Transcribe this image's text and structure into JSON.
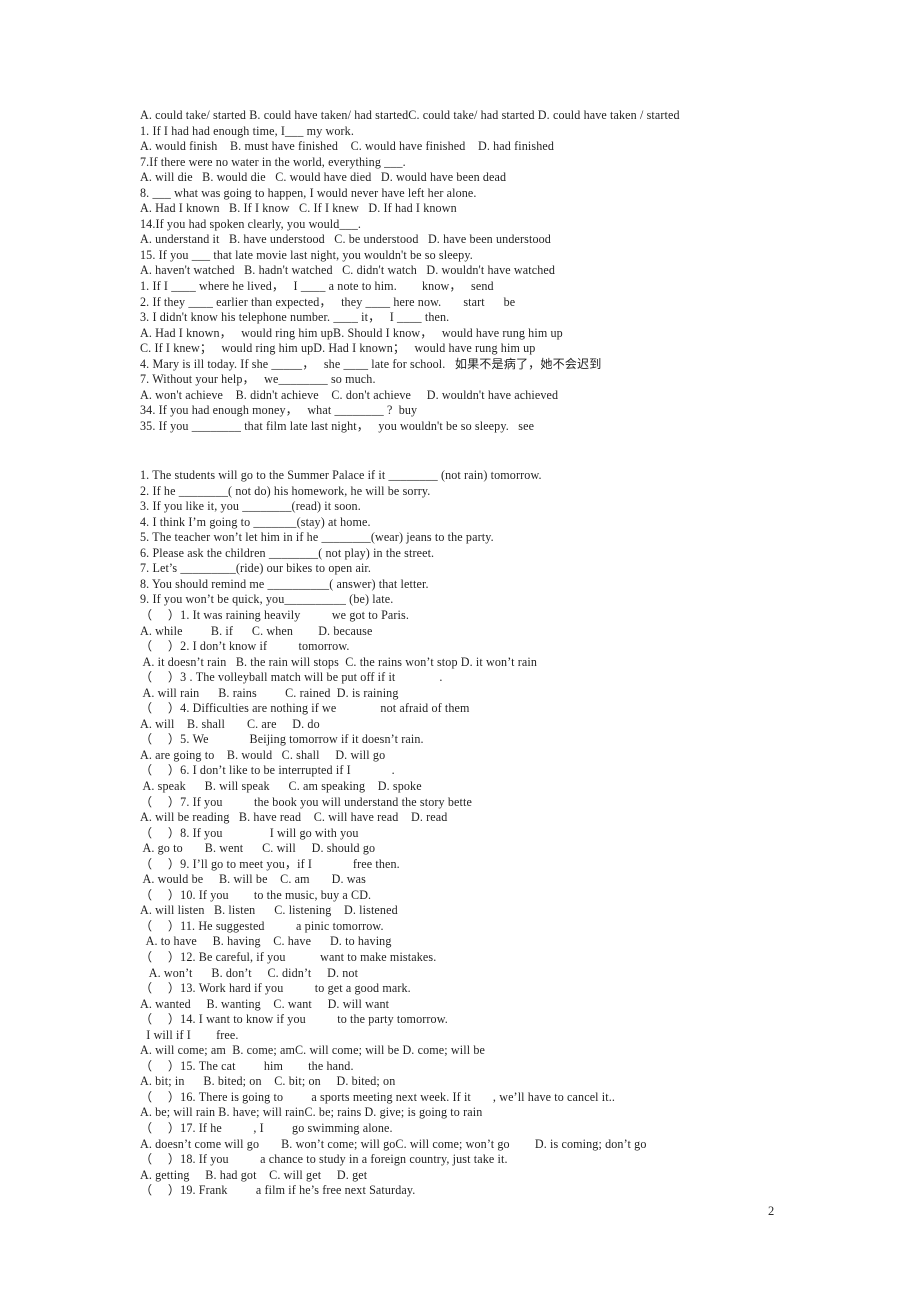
{
  "document": {
    "page_number": "2",
    "sections": [
      {
        "name": "multiple-choice-conditionals",
        "lines": [
          "A. could take/ started B. could have taken/ had startedC. could take/ had started D. could have taken / started",
          "1. If I had had enough time, I___ my work.",
          "A. would finish    B. must have finished    C. would have finished    D. had finished",
          "7.If there were no water in the world, everything ___.",
          "A. will die   B. would die   C. would have died   D. would have been dead",
          "8. ___ what was going to happen, I would never have left her alone.",
          "A. Had I known   B. If I know   C. If I knew   D. If had I known",
          "14.If you had spoken clearly, you would___.",
          "A. understand it   B. have understood   C. be understood   D. have been understood",
          "15. If you ___ that late movie last night, you wouldn't be so sleepy.",
          "A. haven't watched   B. hadn't watched   C. didn't watch   D. wouldn't have watched",
          "1. If I ____ where he lived，   I ____ a note to him.        know，   send",
          "2. If they ____ earlier than expected，   they ____ here now.       start      be",
          "3. I didn't know his telephone number. ____ it，   I ____ then.",
          "A. Had I known，   would ring him upB. Should I know，   would have rung him up",
          "C. If I knew；   would ring him upD. Had I known；   would have rung him up",
          "4. Mary is ill today. If she _____，   she ____ late for school.   如果不是病了，她不会迟到",
          "7. Without your help，   we________ so much.",
          "A. won't achieve    B. didn't achieve    C. don't achieve     D. wouldn't have achieved",
          "34. If you had enough money，   what ________ ?  buy",
          "35. If you ________ that film late last night，   you wouldn't be so sleepy.   see"
        ]
      },
      {
        "name": "fill-in-the-blank-conditionals",
        "lines": [
          "1. The students will go to the Summer Palace if it ________ (not rain) tomorrow.",
          "2. If he ________( not do) his homework, he will be sorry.",
          "3. If you like it, you ________(read) it soon.",
          "4. I think I’m going to _______(stay) at home.",
          "5. The teacher won’t let him in if he ________(wear) jeans to the party.",
          "6. Please ask the children ________( not play) in the street.",
          "7. Let’s _________(ride) our bikes to open air.",
          "8. You should remind me __________( answer) that letter.",
          "9. If you won’t be quick, you__________ (be) late.",
          "（     ）1. It was raining heavily          we got to Paris.",
          "A. while         B. if      C. when        D. because",
          "（     ）2. I don’t know if          tomorrow.",
          " A. it doesn’t rain   B. the rain will stops  C. the rains won’t stop D. it won’t rain",
          "（     ）3 . The volleyball match will be put off if it              .",
          " A. will rain      B. rains         C. rained  D. is raining",
          "（     ）4. Difficulties are nothing if we              not afraid of them",
          "A. will    B. shall       C. are     D. do",
          "（     ）5. We             Beijing tomorrow if it doesn’t rain.",
          "A. are going to    B. would   C. shall     D. will go",
          "（     ）6. I don’t like to be interrupted if I             .",
          " A. speak      B. will speak      C. am speaking    D. spoke",
          "（     ）7. If you          the book you will understand the story bette",
          "A. will be reading   B. have read    C. will have read    D. read",
          "（     ）8. If you               I will go with you",
          " A. go to       B. went      C. will     D. should go",
          "（     ）9. I’ll go to meet you，if I             free then.",
          " A. would be     B. will be    C. am       D. was",
          "（     ）10. If you        to the music, buy a CD.",
          "A. will listen   B. listen      C. listening    D. listened",
          "（     ）11. He suggested          a pinic tomorrow.",
          "  A. to have     B. having    C. have      D. to having",
          "（     ）12. Be careful, if you           want to make mistakes.",
          "   A. won’t      B. don’t     C. didn’t     D. not",
          "（     ）13. Work hard if you          to get a good mark.",
          "A. wanted     B. wanting    C. want     D. will want",
          "（     ）14. I want to know if you          to the party tomorrow.",
          "  I will if I        free.",
          "A. will come; am  B. come; amC. will come; will be D. come; will be",
          "（     ）15. The cat         him        the hand.",
          "A. bit; in      B. bited; on    C. bit; on     D. bited; on",
          "（     ）16. There is going to         a sports meeting next week. If it       , we’ll have to cancel it..",
          "A. be; will rain B. have; will rainC. be; rains D. give; is going to rain",
          "（     ）17. If he          , I         go swimming alone.",
          "A. doesn’t come will go       B. won’t come; will goC. will come; won’t go        D. is coming; don’t go",
          "（     ）18. If you          a chance to study in a foreign country, just take it.",
          "A. getting     B. had got    C. will get     D. get",
          "（     ）19. Frank         a film if he’s free next Saturday."
        ]
      }
    ]
  }
}
